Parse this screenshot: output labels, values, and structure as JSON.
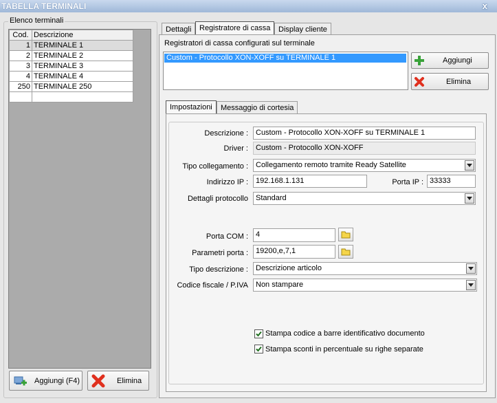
{
  "window": {
    "title": "TABELLA TERMINALI",
    "close_glyph": "x"
  },
  "terminals": {
    "group_title": "Elenco terminali",
    "columns": [
      "Cod.",
      "Descrizione"
    ],
    "rows": [
      {
        "cod": "1",
        "desc": "TERMINALE 1"
      },
      {
        "cod": "2",
        "desc": "TERMINALE 2"
      },
      {
        "cod": "3",
        "desc": "TERMINALE 3"
      },
      {
        "cod": "4",
        "desc": "TERMINALE 4"
      },
      {
        "cod": "250",
        "desc": "TERMINALE 250"
      }
    ],
    "add_label": "Aggiungi (F4)",
    "delete_label": "Elimina"
  },
  "tabs": [
    "Dettagli",
    "Registratore di cassa",
    "Display cliente"
  ],
  "register": {
    "section_label": "Registratori di cassa configurati sul terminale",
    "items": [
      "Custom - Protocollo XON-XOFF su TERMINALE 1"
    ],
    "add_label": "Aggiungi",
    "delete_label": "Elimina"
  },
  "subtabs": [
    "Impostazioni",
    "Messaggio di cortesia"
  ],
  "settings": {
    "descrizione_label": "Descrizione :",
    "descrizione_value": "Custom - Protocollo XON-XOFF su TERMINALE 1",
    "driver_label": "Driver :",
    "driver_value": "Custom - Protocollo XON-XOFF",
    "tipo_collegamento_label": "Tipo collegamento :",
    "tipo_collegamento_value": "Collegamento remoto tramite Ready Satellite",
    "ip_label": "Indirizzo IP :",
    "ip_value": "192.168.1.131",
    "porta_ip_label": "Porta IP :",
    "porta_ip_value": "33333",
    "dettagli_protocollo_label": "Dettagli protocollo",
    "dettagli_protocollo_value": "Standard",
    "porta_com_label": "Porta COM :",
    "porta_com_value": "4",
    "parametri_porta_label": "Parametri porta :",
    "parametri_porta_value": "19200,e,7,1",
    "tipo_descrizione_label": "Tipo descrizione :",
    "tipo_descrizione_value": "Descrizione articolo",
    "codice_fiscale_label": "Codice fiscale / P.IVA",
    "codice_fiscale_value": "Non stampare",
    "check1_label": "Stampa codice a barre identificativo documento",
    "check1_checked": true,
    "check2_label": "Stampa sconti in percentuale su righe separate",
    "check2_checked": true
  },
  "colors": {
    "selection": "#3399ff",
    "title_bar": "#9fb8d8",
    "add_icon": "#3aa23a",
    "delete_icon": "#e0301e"
  }
}
